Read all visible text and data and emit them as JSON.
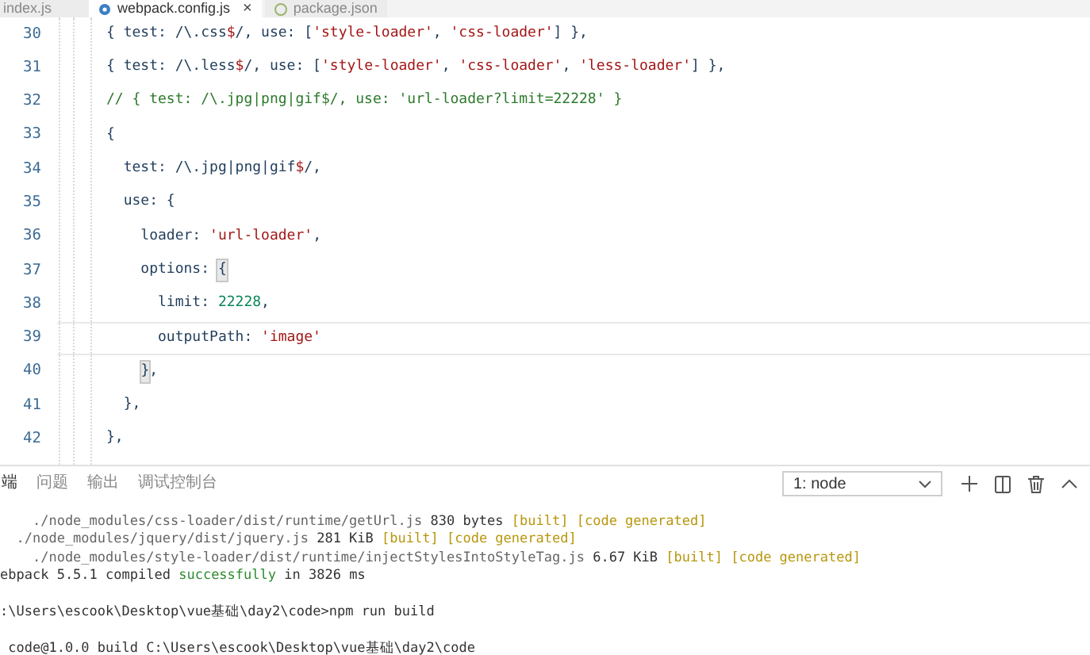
{
  "editor_tabs": [
    {
      "label": "index.js",
      "selected": false,
      "icon": false,
      "closable": false
    },
    {
      "label": "webpack.config.js",
      "selected": true,
      "icon": true,
      "closable": true
    },
    {
      "label": "package.json",
      "selected": false,
      "icon": true,
      "closable": false
    }
  ],
  "close_glyph": "×",
  "code_lines": [
    {
      "number": "30",
      "current": false,
      "tokens": [
        {
          "kind": "plain",
          "text": "{ test: /\\.css"
        },
        {
          "kind": "regex",
          "text": "$"
        },
        {
          "kind": "plain",
          "text": "/, use: ["
        },
        {
          "kind": "string",
          "text": "'style-loader'"
        },
        {
          "kind": "plain",
          "text": ", "
        },
        {
          "kind": "string",
          "text": "'css-loader'"
        },
        {
          "kind": "plain",
          "text": "] },"
        }
      ]
    },
    {
      "number": "31",
      "current": false,
      "tokens": [
        {
          "kind": "plain",
          "text": "{ test: /\\.less"
        },
        {
          "kind": "regex",
          "text": "$"
        },
        {
          "kind": "plain",
          "text": "/, use: ["
        },
        {
          "kind": "string",
          "text": "'style-loader'"
        },
        {
          "kind": "plain",
          "text": ", "
        },
        {
          "kind": "string",
          "text": "'css-loader'"
        },
        {
          "kind": "plain",
          "text": ", "
        },
        {
          "kind": "string",
          "text": "'less-loader'"
        },
        {
          "kind": "plain",
          "text": "] },"
        }
      ]
    },
    {
      "number": "32",
      "current": false,
      "tokens": [
        {
          "kind": "comment",
          "text": "// { test: /\\.jpg|png|gif$/, use: 'url-loader?limit=22228' }"
        }
      ]
    },
    {
      "number": "33",
      "current": false,
      "tokens": [
        {
          "kind": "plain",
          "text": "{"
        }
      ]
    },
    {
      "number": "34",
      "current": false,
      "tokens": [
        {
          "kind": "plain",
          "text": "  test: /\\.jpg|png|gif"
        },
        {
          "kind": "regex",
          "text": "$"
        },
        {
          "kind": "plain",
          "text": "/,"
        }
      ]
    },
    {
      "number": "35",
      "current": false,
      "tokens": [
        {
          "kind": "plain",
          "text": "  use: {"
        }
      ]
    },
    {
      "number": "36",
      "current": false,
      "tokens": [
        {
          "kind": "plain",
          "text": "    loader: "
        },
        {
          "kind": "string",
          "text": "'url-loader'"
        },
        {
          "kind": "plain",
          "text": ","
        }
      ]
    },
    {
      "number": "37",
      "current": false,
      "tokens": [
        {
          "kind": "plain",
          "text": "    options: "
        },
        {
          "kind": "bracket",
          "text": "{"
        }
      ]
    },
    {
      "number": "38",
      "current": false,
      "tokens": [
        {
          "kind": "plain",
          "text": "      limit: "
        },
        {
          "kind": "number",
          "text": "22228"
        },
        {
          "kind": "plain",
          "text": ","
        }
      ]
    },
    {
      "number": "39",
      "current": true,
      "tokens": [
        {
          "kind": "plain",
          "text": "      outputPath: "
        },
        {
          "kind": "string",
          "text": "'image'"
        }
      ]
    },
    {
      "number": "40",
      "current": false,
      "tokens": [
        {
          "kind": "bracket",
          "text": "    }"
        },
        {
          "kind": "plain",
          "text": ","
        }
      ]
    },
    {
      "number": "41",
      "current": false,
      "tokens": [
        {
          "kind": "plain",
          "text": "  },"
        }
      ]
    },
    {
      "number": "42",
      "current": false,
      "tokens": [
        {
          "kind": "plain",
          "text": "},"
        }
      ]
    }
  ],
  "panel_tabs": [
    {
      "label": "端",
      "selected": true
    },
    {
      "label": "问题",
      "selected": false
    },
    {
      "label": "输出",
      "selected": false
    },
    {
      "label": "调试控制台",
      "selected": false
    }
  ],
  "terminal_select": {
    "value": "1: node"
  },
  "terminal_output": [
    {
      "lines": [
        [
          {
            "kind": "path",
            "text": "    ./node_modules/css-loader/dist/runtime/getUrl.js"
          },
          {
            "kind": "plain",
            "text": " 830 bytes "
          },
          {
            "kind": "yellow",
            "text": "[built] [code generated]"
          }
        ],
        [
          {
            "kind": "path",
            "text": "  ./node_modules/jquery/dist/jquery.js"
          },
          {
            "kind": "plain",
            "text": " 281 KiB "
          },
          {
            "kind": "yellow",
            "text": "[built] [code generated]"
          }
        ],
        [
          {
            "kind": "path",
            "text": "    ./node_modules/style-loader/dist/runtime/injectStylesIntoStyleTag.js"
          },
          {
            "kind": "plain",
            "text": " 6.67 KiB "
          },
          {
            "kind": "yellow",
            "text": "[built] [code generated]"
          }
        ],
        [
          {
            "kind": "plain",
            "text": "ebpack 5.5.1 compiled "
          },
          {
            "kind": "green",
            "text": "successfully"
          },
          {
            "kind": "plain",
            "text": " in 3826 ms"
          }
        ]
      ]
    },
    {
      "lines": [
        [
          {
            "kind": "plain",
            "text": ":\\Users\\escook\\Desktop\\vue基础\\day2\\code>npm run build"
          }
        ]
      ]
    },
    {
      "lines": [
        [
          {
            "kind": "plain",
            "text": " code@1.0.0 build C:\\Users\\escook\\Desktop\\vue基础\\day2\\code"
          }
        ]
      ]
    }
  ]
}
